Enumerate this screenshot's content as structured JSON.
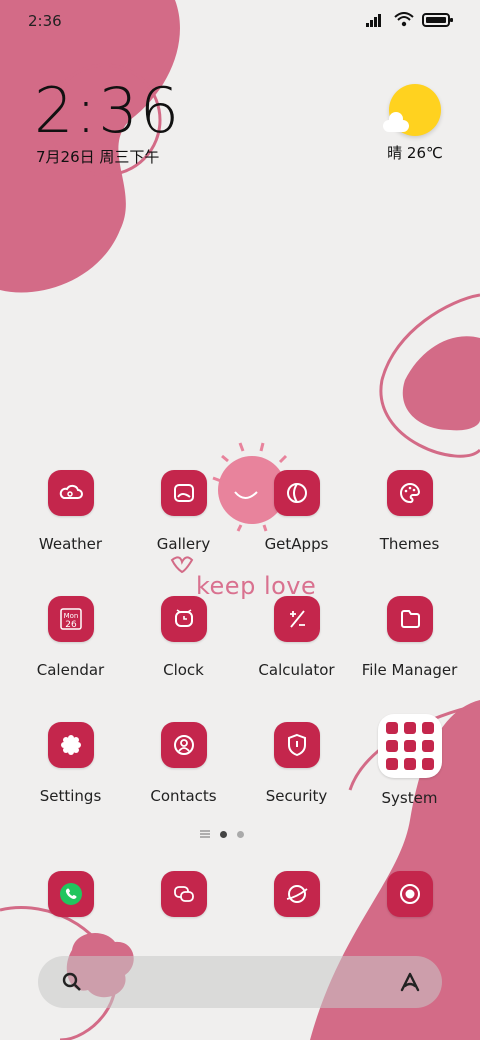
{
  "status_bar": {
    "time": "2:36"
  },
  "lock_widget": {
    "time": "2:36",
    "date": "7月26日 周三下午"
  },
  "weather_widget": {
    "text": "晴 26℃"
  },
  "decor_text": "keep love",
  "apps": [
    {
      "label": "Weather",
      "icon": "weather-icon"
    },
    {
      "label": "Gallery",
      "icon": "gallery-icon"
    },
    {
      "label": "GetApps",
      "icon": "getapps-icon"
    },
    {
      "label": "Themes",
      "icon": "palette-icon"
    },
    {
      "label": "Calendar",
      "icon": "calendar-icon",
      "calendar": {
        "month": "Mon",
        "day": "26"
      }
    },
    {
      "label": "Clock",
      "icon": "clock-icon"
    },
    {
      "label": "Calculator",
      "icon": "calculator-icon"
    },
    {
      "label": "File Manager",
      "icon": "folder-icon"
    },
    {
      "label": "Settings",
      "icon": "gear-icon"
    },
    {
      "label": "Contacts",
      "icon": "contacts-icon"
    },
    {
      "label": "Security",
      "icon": "shield-icon"
    },
    {
      "label": "System",
      "icon": "folder-grid-icon"
    }
  ],
  "dock": [
    {
      "icon": "phone-icon"
    },
    {
      "icon": "messages-icon"
    },
    {
      "icon": "browser-icon"
    },
    {
      "icon": "camera-icon"
    }
  ],
  "colors": {
    "accent": "#c4264c",
    "blob": "#d36b87",
    "background": "#f0efee"
  }
}
